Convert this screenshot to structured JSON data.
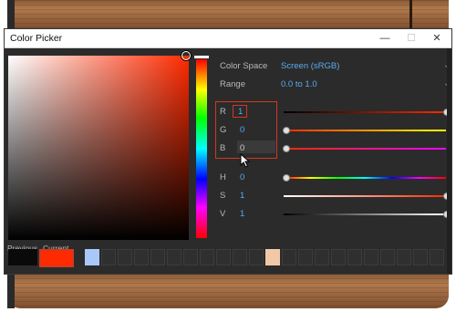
{
  "window": {
    "title": "Color Picker",
    "controls": {
      "minimize": "—",
      "maximize": "☐",
      "close": "✕"
    }
  },
  "settings": {
    "color_space_label": "Color Space",
    "color_space_value": "Screen (sRGB)",
    "range_label": "Range",
    "range_value": "0.0 to 1.0"
  },
  "channels": {
    "r": {
      "label": "R",
      "value": "1"
    },
    "g": {
      "label": "G",
      "value": "0"
    },
    "b": {
      "label": "B",
      "value": "0"
    },
    "h": {
      "label": "H",
      "value": "0"
    },
    "s": {
      "label": "S",
      "value": "1"
    },
    "v": {
      "label": "V",
      "value": "1"
    }
  },
  "swatches": {
    "previous_label": "Previous",
    "current_label": "Current",
    "previous_color": "#0a0a0a",
    "current_color": "#ff2a00",
    "saved_colors": [
      "#a8c8f8",
      "#f2c9a8"
    ]
  },
  "colors": {
    "accent": "#5da9ef",
    "highlight_border": "#d0391e"
  }
}
